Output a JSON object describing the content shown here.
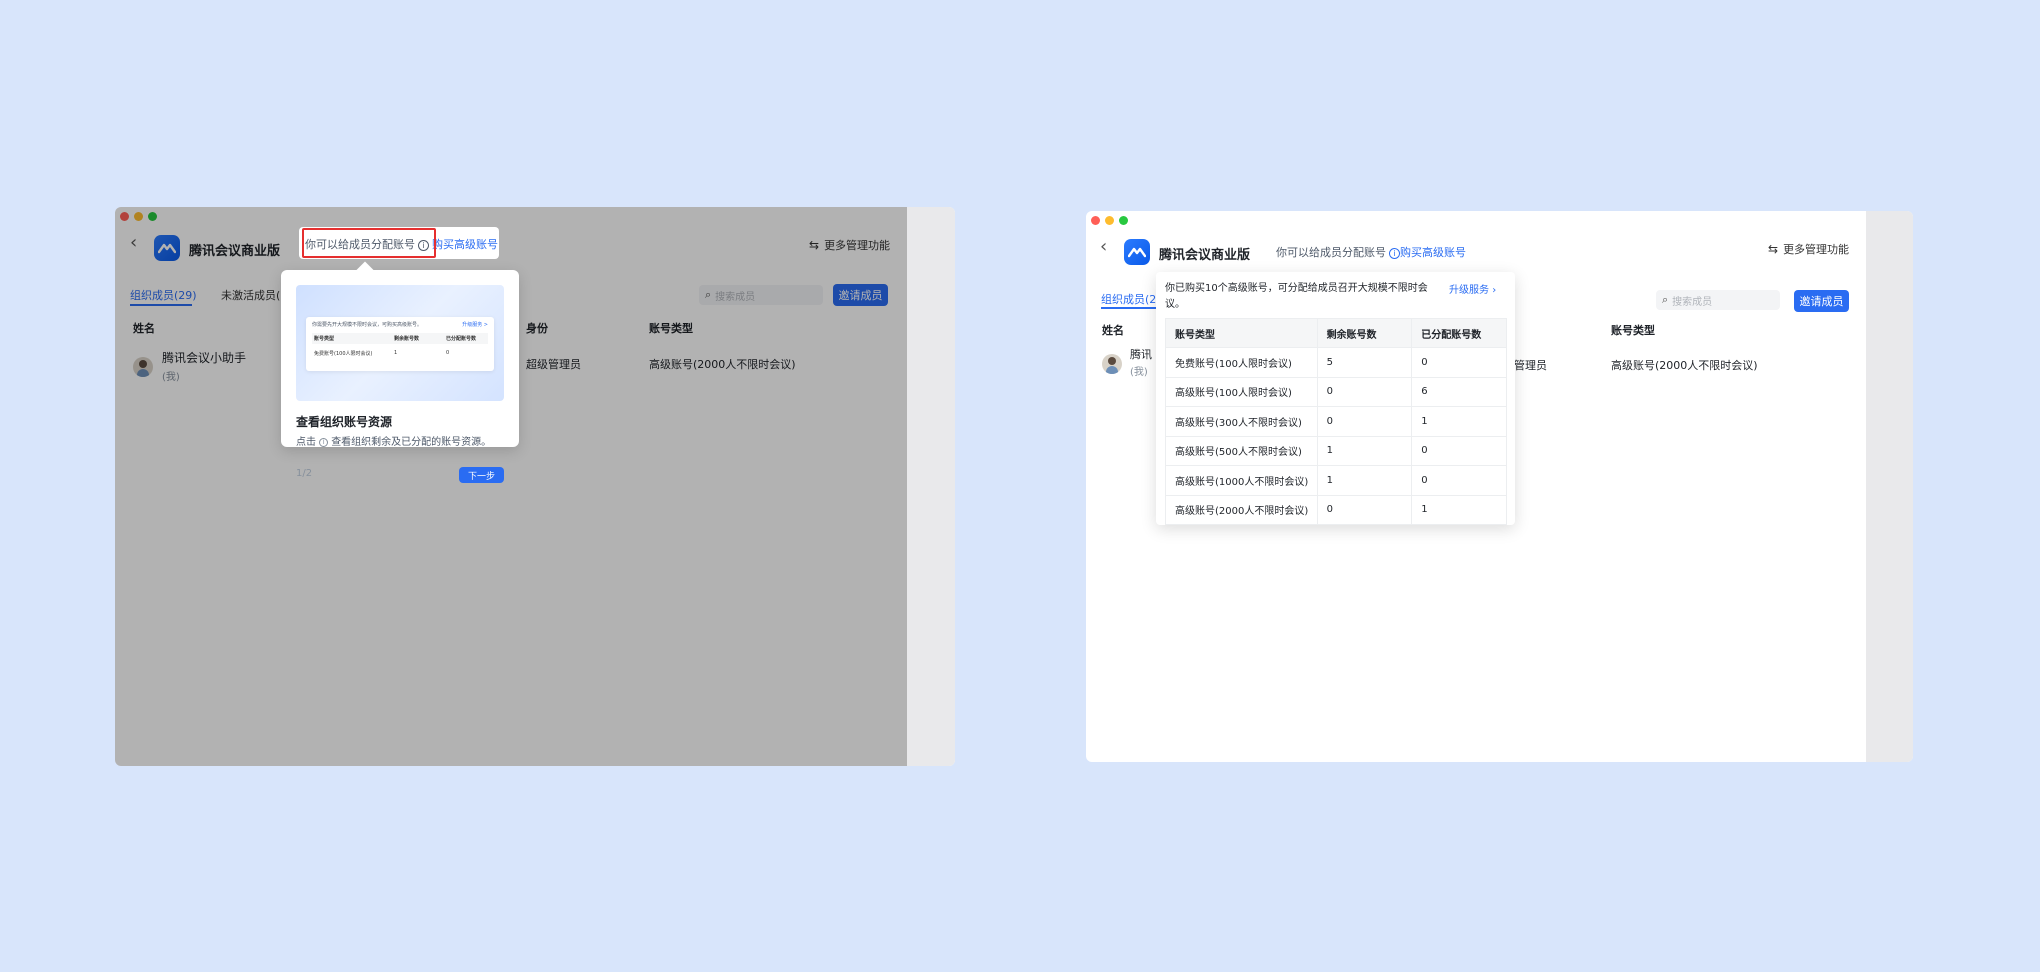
{
  "app": {
    "brand": "腾讯会议商业版",
    "hint": "你可以给成员分配账号",
    "buy_link": "购买高级账号",
    "more_label": "更多管理功能",
    "tab_active": "组织成员(29)",
    "tab_inactive": "未激活成员(3",
    "tab_active_short": "组织成员(29",
    "search_placeholder": "搜索成员",
    "invite_label": "邀请成员"
  },
  "columns": {
    "name": "姓名",
    "role": "身份",
    "account_type": "账号类型"
  },
  "member": {
    "name": "腾讯会议小助手",
    "name_short": "腾讯",
    "tag": "(我)",
    "role": "超级管理员",
    "role_partial": "管理员",
    "account_type": "高级账号(2000人不限时会议)"
  },
  "guide": {
    "title": "查看组织账号资源",
    "desc_before": "点击",
    "desc_after": "查看组织剩余及已分配的账号资源。",
    "step": "1/2",
    "next": "下一步",
    "mini": {
      "text": "你需要先开大规模不限时会议，可购买高级账号。",
      "link": "升级服务 >",
      "h1": "账号类型",
      "h2": "剩余账号数",
      "h3": "已分配账号数",
      "r1": "免费账号(100人限时会议)",
      "r2": "1",
      "r3": "0"
    }
  },
  "popover": {
    "text": "你已购买10个高级账号，可分配给成员召开大规模不限时会议。",
    "upgrade": "升级服务",
    "headers": [
      "账号类型",
      "剩余账号数",
      "已分配账号数"
    ],
    "rows": [
      [
        "免费账号(100人限时会议)",
        "5",
        "0"
      ],
      [
        "高级账号(100人限时会议)",
        "0",
        "6"
      ],
      [
        "高级账号(300人不限时会议)",
        "0",
        "1"
      ],
      [
        "高级账号(500人不限时会议)",
        "1",
        "0"
      ],
      [
        "高级账号(1000人不限时会议)",
        "1",
        "0"
      ],
      [
        "高级账号(2000人不限时会议)",
        "0",
        "1"
      ]
    ]
  },
  "colors": {
    "accent": "#2a6cf2",
    "highlight_frame": "#e52f2f",
    "background": "#d8e5fb"
  }
}
